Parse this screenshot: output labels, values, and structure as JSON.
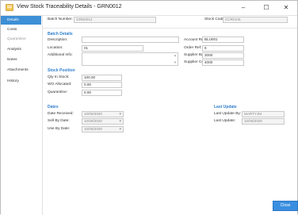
{
  "window": {
    "title": "View Stock Traceability Details - GRN0012",
    "controls": {
      "minimize": "–",
      "maximize": "☐",
      "close": "✕"
    }
  },
  "sidebar": {
    "items": [
      {
        "label": "Details",
        "state": "active"
      },
      {
        "label": "Costs",
        "state": "normal"
      },
      {
        "label": "Quarantine",
        "state": "disabled"
      },
      {
        "label": "Analysis",
        "state": "normal"
      },
      {
        "label": "Notes",
        "state": "normal"
      },
      {
        "label": "Attachments",
        "state": "normal"
      },
      {
        "label": "History",
        "state": "normal"
      }
    ]
  },
  "header": {
    "batch_number_label": "Batch Number:",
    "batch_number_value": "GRN0012",
    "stock_code_label": "Stock Code:",
    "stock_code_value": "CCRIVA5"
  },
  "batch_details": {
    "section_title": "Batch Details",
    "description_label": "Description:",
    "description_value": "",
    "location_label": "Location:",
    "location_value": "01",
    "additional_info_label": "Additional Info:",
    "account_ref_label": "Account Ref:",
    "account_ref_value": "BLU001",
    "order_ref_label": "Order Ref:",
    "order_ref_value": "8",
    "supplier_batch_label": "Supplier Batch:",
    "supplier_batch_value": "3000",
    "supplier_cert_label": "Supplier Cert:",
    "supplier_cert_value": "4000"
  },
  "stock_position": {
    "section_title": "Stock Position",
    "qty_in_stock_label": "Qty In Stock:",
    "qty_in_stock_value": "100.00",
    "wo_allocated_label": "WO Allocated:",
    "wo_allocated_value": "0.00",
    "quarantine_label": "Quarantine:",
    "quarantine_value": "0.00"
  },
  "dates": {
    "section_title": "Dates",
    "date_received_label": "Date Received:",
    "date_received_value": "10/06/2020",
    "sell_by_label": "Sell By Date:",
    "sell_by_value": "10/06/2020",
    "use_by_label": "Use By Date:",
    "use_by_value": "10/06/2020"
  },
  "last_update": {
    "section_title": "Last Update",
    "by_label": "Last Update By:",
    "by_value": "MARTYJM",
    "date_label": "Last Update:",
    "date_value": "10/06/2020"
  },
  "footer": {
    "close_label": "Close"
  },
  "colors": {
    "accent": "#3d8fd6",
    "section": "#2f7fd0"
  }
}
